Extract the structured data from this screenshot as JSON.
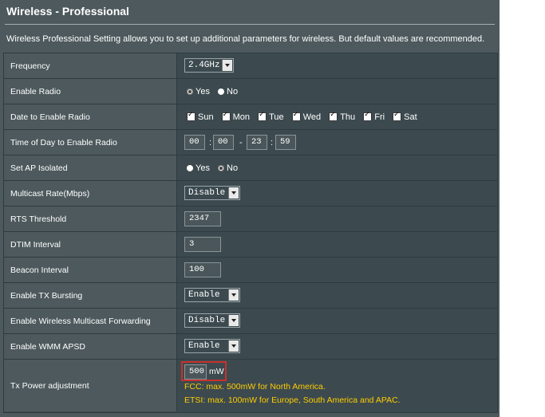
{
  "page": {
    "title": "Wireless - Professional",
    "description": "Wireless Professional Setting allows you to set up additional parameters for wireless. But default values are recommended."
  },
  "colors": {
    "panel_bg": "#4d595d",
    "field_bg": "#3c4a4f",
    "highlight_border": "#c9302c",
    "note_text": "#ffcc00"
  },
  "rows": {
    "frequency": {
      "label": "Frequency",
      "value": "2.4GHz"
    },
    "enable_radio": {
      "label": "Enable Radio",
      "yes": "Yes",
      "no": "No",
      "selected": "Yes"
    },
    "date_enable": {
      "label": "Date to Enable Radio",
      "days": [
        "Sun",
        "Mon",
        "Tue",
        "Wed",
        "Thu",
        "Fri",
        "Sat"
      ],
      "checked": [
        true,
        true,
        true,
        true,
        true,
        true,
        true
      ]
    },
    "time_enable": {
      "label": "Time of Day to Enable Radio",
      "start_hour": "00",
      "start_min": "00",
      "end_hour": "23",
      "end_min": "59",
      "colon": ":",
      "dash": "-"
    },
    "ap_isolated": {
      "label": "Set AP Isolated",
      "yes": "Yes",
      "no": "No",
      "selected": "No"
    },
    "multicast_rate": {
      "label": "Multicast Rate(Mbps)",
      "value": "Disable"
    },
    "rts": {
      "label": "RTS Threshold",
      "value": "2347"
    },
    "dtim": {
      "label": "DTIM Interval",
      "value": "3"
    },
    "beacon": {
      "label": "Beacon Interval",
      "value": "100"
    },
    "tx_bursting": {
      "label": "Enable TX Bursting",
      "value": "Enable"
    },
    "multicast_fwd": {
      "label": "Enable Wireless Multicast Forwarding",
      "value": "Disable"
    },
    "wmm_apsd": {
      "label": "Enable WMM APSD",
      "value": "Enable"
    },
    "tx_power": {
      "label": "Tx Power adjustment",
      "value": "500",
      "unit": "mW",
      "note_fcc": "FCC: max. 500mW for North America.",
      "note_etsi": "ETSI: max. 100mW for Europe, South America and APAC."
    }
  }
}
